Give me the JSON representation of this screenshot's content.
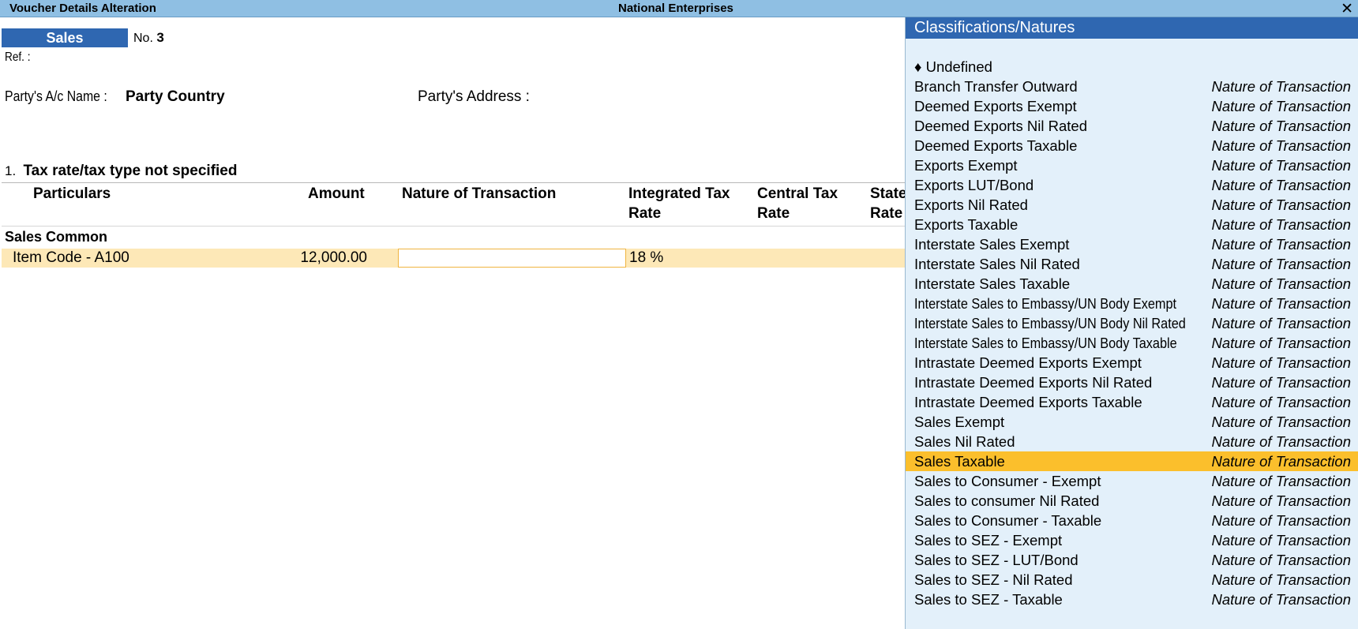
{
  "titlebar": {
    "screen_title": "Voucher Details Alteration",
    "company": "National Enterprises",
    "close_glyph": "✕"
  },
  "voucher": {
    "type": "Sales",
    "number_label": "No.",
    "number": "3",
    "ref_label": "Ref. :",
    "party_label": "Party's A/c Name :",
    "party_value": "Party Country",
    "address_label": "Party's Address  :"
  },
  "section": {
    "number": "1.",
    "title": "Tax rate/tax type not specified"
  },
  "table": {
    "headers": {
      "particulars": "Particulars",
      "amount": "Amount",
      "nature": "Nature of Transaction",
      "igst_line1": "Integrated Tax",
      "igst_line2": "Rate",
      "cgst_line1": "Central Tax",
      "cgst_line2": "Rate",
      "sgst_line1": "State",
      "sgst_line2": "Rate"
    },
    "group": "Sales Common",
    "rows": [
      {
        "item": "Item Code - A100",
        "amount": "12,000.00",
        "nature": "",
        "igst_rate": "18 %"
      }
    ]
  },
  "panel": {
    "title": "Classifications/Natures",
    "undefined_label": "♦ Undefined",
    "type_label": "Nature of Transaction",
    "selected_index": 20,
    "items": [
      "Branch Transfer Outward",
      "Deemed Exports Exempt",
      "Deemed Exports Nil Rated",
      "Deemed Exports Taxable",
      "Exports Exempt",
      "Exports LUT/Bond",
      "Exports Nil Rated",
      "Exports Taxable",
      "Interstate Sales Exempt",
      "Interstate Sales Nil Rated",
      "Interstate Sales Taxable",
      "Interstate Sales to Embassy/UN Body Exempt",
      "Interstate Sales to Embassy/UN Body Nil Rated",
      "Interstate Sales to Embassy/UN Body Taxable",
      "Intrastate Deemed Exports Exempt",
      "Intrastate Deemed Exports Nil Rated",
      "Intrastate Deemed Exports Taxable",
      "Sales Exempt",
      "Sales Nil Rated",
      "Sales Taxable",
      "Sales to Consumer - Exempt",
      "Sales to consumer Nil Rated",
      "Sales to Consumer - Taxable",
      "Sales to SEZ - Exempt",
      "Sales to SEZ - LUT/Bond",
      "Sales to SEZ - Nil Rated",
      "Sales to SEZ - Taxable"
    ]
  },
  "colors": {
    "titlebar": "#8fbfe3",
    "accent_blue": "#2f67b1",
    "row_highlight": "#fde8b7",
    "selection": "#fbbf2c",
    "panel_bg": "#e3f0fa"
  }
}
